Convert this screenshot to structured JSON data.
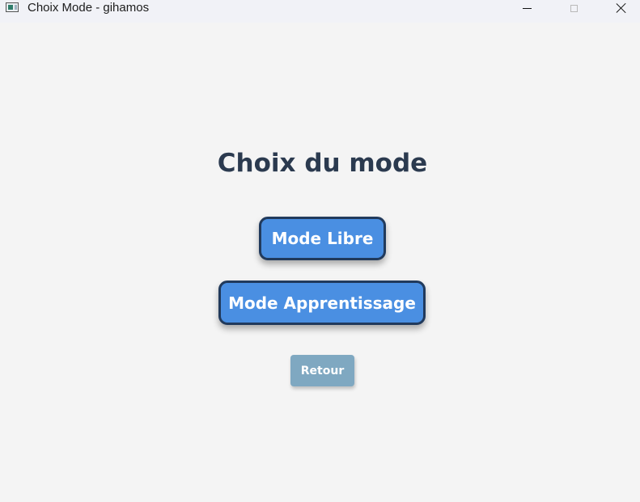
{
  "window": {
    "title": "Choix Mode - gihamos",
    "controls": {
      "minimize_icon": "minimize-icon",
      "maximize_icon": "maximize-icon",
      "close_icon": "close-icon"
    }
  },
  "main": {
    "heading": "Choix du mode",
    "buttons": {
      "mode_libre": "Mode Libre",
      "mode_apprentissage": "Mode Apprentissage",
      "retour": "Retour"
    }
  },
  "colors": {
    "background": "#f4f4f4",
    "heading": "#2b3a4f",
    "primary_button": "#4a8fe2",
    "primary_button_border": "#213a5c",
    "secondary_button": "#7fa8c1",
    "button_text": "#ffffff"
  }
}
